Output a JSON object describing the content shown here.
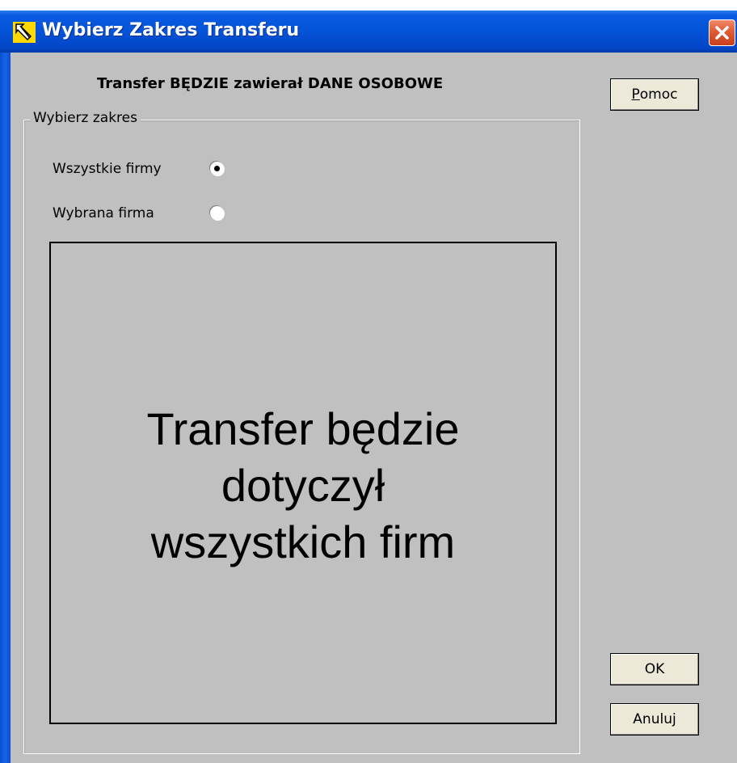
{
  "window": {
    "title": "Wybierz Zakres Transferu",
    "title_icon": "app-icon",
    "close_icon": "close-icon"
  },
  "header": {
    "text": "Transfer BĘDZIE zawierał DANE OSOBOWE"
  },
  "group": {
    "label": "Wybierz zakres",
    "options": [
      {
        "label": "Wszystkie firmy",
        "selected": true
      },
      {
        "label": "Wybrana firma",
        "selected": false
      }
    ]
  },
  "info": {
    "lines": [
      "Transfer będzie",
      "dotyczył",
      "wszystkich firm"
    ]
  },
  "buttons": {
    "help_prefix": "P",
    "help_rest": "omoc",
    "ok": "OK",
    "cancel": "Anuluj"
  },
  "colors": {
    "titlebar": "#0453d8",
    "dialog_bg": "#c0c0c0",
    "button_face": "#ece9d8",
    "close_button": "#e05a33"
  }
}
